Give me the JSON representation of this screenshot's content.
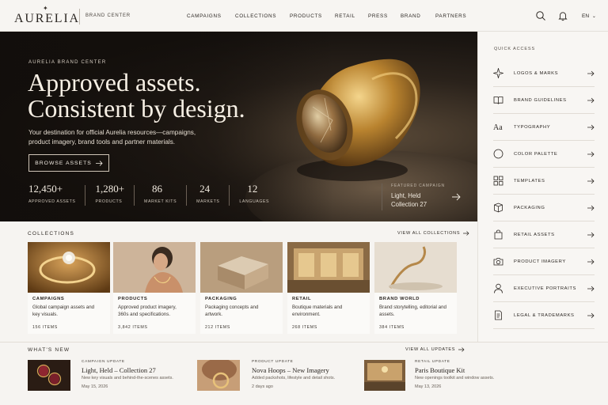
{
  "header": {
    "logo": "AURELIA",
    "brand_center": "BRAND CENTER",
    "nav": [
      "CAMPAIGNS",
      "COLLECTIONS",
      "PRODUCTS",
      "RETAIL",
      "PRESS",
      "BRAND",
      "PARTNERS"
    ],
    "language": "EN"
  },
  "hero": {
    "eyebrow": "AURELIA BRAND CENTER",
    "title_line1": "Approved assets.",
    "title_line2": "Consistent by design.",
    "description": "Your destination for official Aurelia resources—campaigns, product imagery, brand tools and partner materials.",
    "cta": "BROWSE ASSETS",
    "stats": [
      {
        "value": "12,450+",
        "label": "APPROVED ASSETS"
      },
      {
        "value": "1,280+",
        "label": "PRODUCTS"
      },
      {
        "value": "86",
        "label": "MARKET KITS"
      },
      {
        "value": "24",
        "label": "MARKETS"
      },
      {
        "value": "12",
        "label": "LANGUAGES"
      }
    ],
    "featured_eyebrow": "FEATURED CAMPAIGN",
    "featured_title": "Light, Held Collection 27"
  },
  "quick_access": {
    "title": "QUICK ACCESS",
    "items": [
      {
        "label": "LOGOS & MARKS",
        "icon": "sparkle-icon"
      },
      {
        "label": "BRAND GUIDELINES",
        "icon": "book-icon"
      },
      {
        "label": "TYPOGRAPHY",
        "icon": "typography-icon"
      },
      {
        "label": "COLOR PALETTE",
        "icon": "circle-icon"
      },
      {
        "label": "TEMPLATES",
        "icon": "grid-icon"
      },
      {
        "label": "PACKAGING",
        "icon": "package-icon"
      },
      {
        "label": "RETAIL ASSETS",
        "icon": "shopping-bag-icon"
      },
      {
        "label": "PRODUCT IMAGERY",
        "icon": "camera-icon"
      },
      {
        "label": "EXECUTIVE PORTRAITS",
        "icon": "person-icon"
      },
      {
        "label": "LEGAL & TRADEMARKS",
        "icon": "document-icon"
      }
    ]
  },
  "collections": {
    "title": "COLLECTIONS",
    "view_all": "VIEW ALL COLLECTIONS",
    "cards": [
      {
        "title": "CAMPAIGNS",
        "desc": "Global campaign assets and key visuals.",
        "count": "156 ITEMS"
      },
      {
        "title": "PRODUCTS",
        "desc": "Approved product imagery, 360s and specifications.",
        "count": "3,842 ITEMS"
      },
      {
        "title": "PACKAGING",
        "desc": "Packaging concepts and artwork.",
        "count": "212 ITEMS"
      },
      {
        "title": "RETAIL",
        "desc": "Boutique materials and environment.",
        "count": "268 ITEMS"
      },
      {
        "title": "BRAND WORLD",
        "desc": "Brand storytelling, editorial and assets.",
        "count": "384 ITEMS"
      }
    ]
  },
  "whats_new": {
    "title": "WHAT'S NEW",
    "view_all": "VIEW ALL UPDATES",
    "items": [
      {
        "eyebrow": "CAMPAIGN UPDATE",
        "title": "Light, Held – Collection 27",
        "desc": "New key visuals and behind-the-scenes assets.",
        "date": "May 15, 2026"
      },
      {
        "eyebrow": "PRODUCT UPDATE",
        "title": "Nova Hoops – New Imagery",
        "desc": "Added packshots, lifestyle and detail shots.",
        "date": "2 days ago"
      },
      {
        "eyebrow": "RETAIL UPDATE",
        "title": "Paris Boutique Kit",
        "desc": "New openings toolkit and window assets.",
        "date": "May 13, 2026"
      }
    ]
  },
  "colors": {
    "accent_gold": "#c9a15a",
    "hero_dark": "#15110e",
    "panel": "#f8f6f3"
  }
}
